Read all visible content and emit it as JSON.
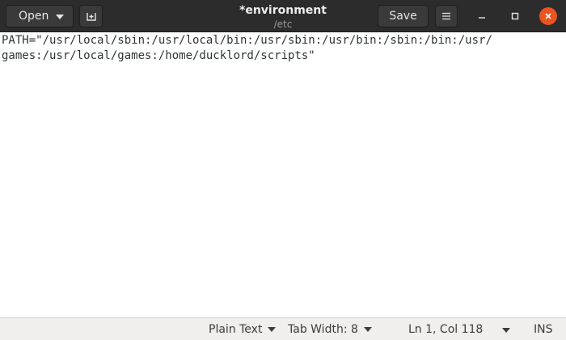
{
  "header": {
    "open_label": "Open",
    "save_label": "Save",
    "title": "*environment",
    "subtitle": "/etc"
  },
  "editor": {
    "lines": [
      "PATH=\"/usr/local/sbin:/usr/local/bin:/usr/sbin:/usr/bin:/sbin:/bin:/usr/",
      "games:/usr/local/games:/home/ducklord/scripts\""
    ]
  },
  "status": {
    "language": "Plain Text",
    "tab_width": "Tab Width: 8",
    "position": "Ln 1, Col 118",
    "mode": "INS"
  },
  "colors": {
    "headerbar": "#2c2c2c",
    "close_button": "#e95420",
    "statusbar": "#f0efee"
  },
  "icons": [
    "new-document-icon",
    "hamburger-menu-icon",
    "minimize-icon",
    "maximize-icon",
    "close-icon"
  ]
}
